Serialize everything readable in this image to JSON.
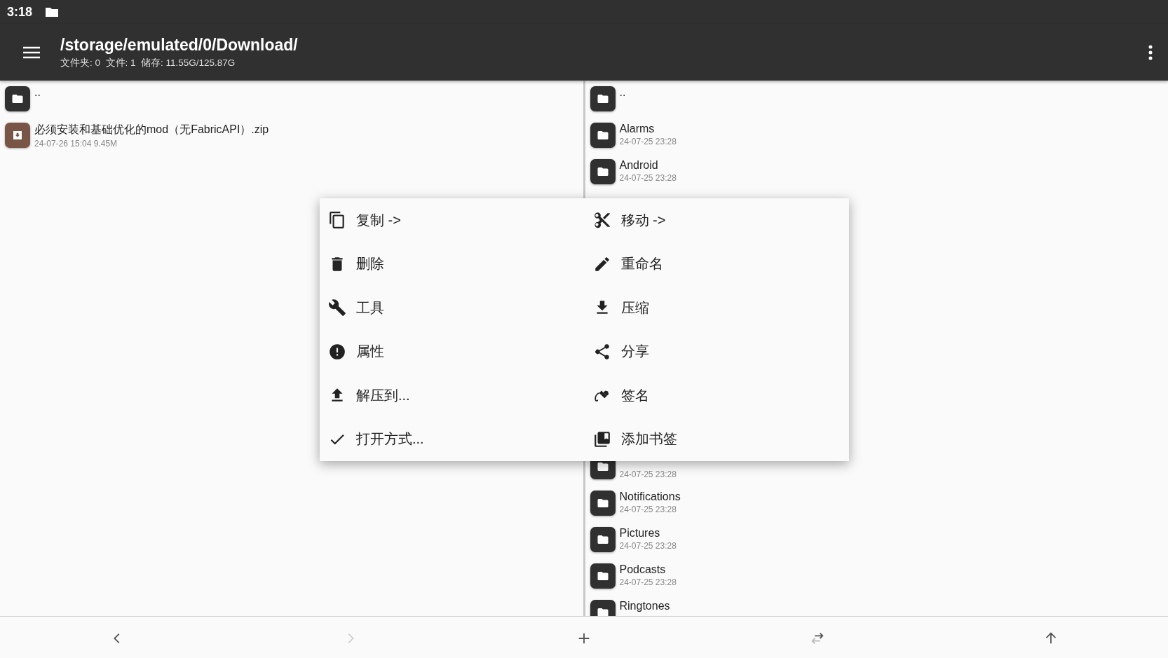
{
  "status_bar": {
    "time": "3:18"
  },
  "app_bar": {
    "path": "/storage/emulated/0/Download/",
    "info": "文件夹: 0  文件: 1  储存: 11.55G/125.87G"
  },
  "left_pane": {
    "items": [
      {
        "kind": "parent",
        "name": ".."
      },
      {
        "kind": "archive",
        "name": "必须安装和基础优化的mod（无FabricAPI）.zip",
        "meta": "24-07-26 15:04  9.45M"
      }
    ]
  },
  "right_pane": {
    "items": [
      {
        "kind": "parent",
        "name": ".."
      },
      {
        "kind": "folder",
        "name": "Alarms",
        "meta": "24-07-25 23:28"
      },
      {
        "kind": "folder",
        "name": "Android",
        "meta": "24-07-25 23:28"
      },
      {
        "kind": "covered"
      },
      {
        "kind": "folder",
        "meta": "24-07-25 23:28"
      },
      {
        "kind": "folder",
        "name": "Notifications",
        "meta": "24-07-25 23:28"
      },
      {
        "kind": "folder",
        "name": "Pictures",
        "meta": "24-07-25 23:28"
      },
      {
        "kind": "folder",
        "name": "Podcasts",
        "meta": "24-07-25 23:28"
      },
      {
        "kind": "folder",
        "name": "Ringtones"
      }
    ]
  },
  "menu": {
    "items": [
      {
        "kind": "copy",
        "label": "复制 ->"
      },
      {
        "kind": "move",
        "label": "移动 ->"
      },
      {
        "kind": "delete",
        "label": "删除"
      },
      {
        "kind": "rename",
        "label": "重命名"
      },
      {
        "kind": "tools",
        "label": "工具"
      },
      {
        "kind": "compress",
        "label": "压缩"
      },
      {
        "kind": "properties",
        "label": "属性"
      },
      {
        "kind": "share",
        "label": "分享"
      },
      {
        "kind": "extract",
        "label": "解压到..."
      },
      {
        "kind": "sign",
        "label": "签名"
      },
      {
        "kind": "open_with",
        "label": "打开方式..."
      },
      {
        "kind": "bookmark",
        "label": "添加书签"
      }
    ]
  },
  "bottom_bar": [
    {
      "kind": "back",
      "disabled": false
    },
    {
      "kind": "forward",
      "disabled": true
    },
    {
      "kind": "add",
      "disabled": false
    },
    {
      "kind": "swap",
      "disabled": false
    },
    {
      "kind": "up",
      "disabled": false
    }
  ]
}
